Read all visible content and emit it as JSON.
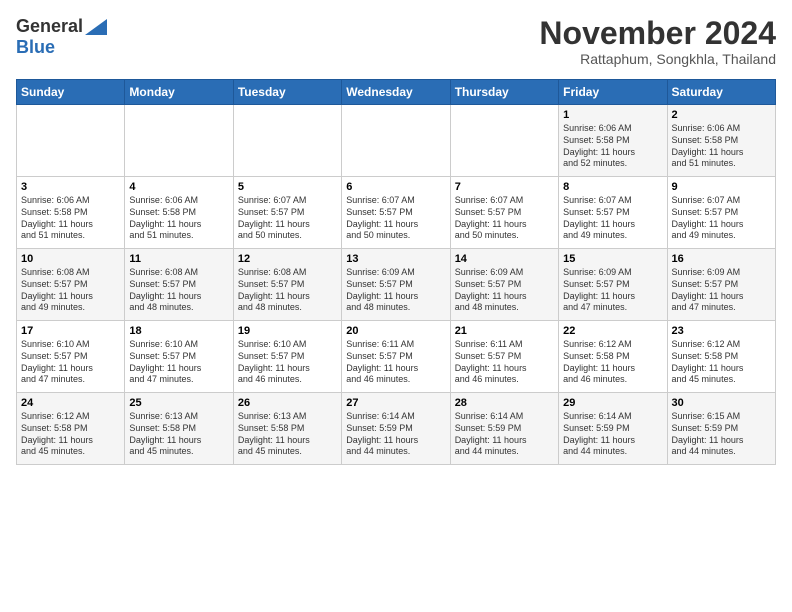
{
  "header": {
    "logo_general": "General",
    "logo_blue": "Blue",
    "month_title": "November 2024",
    "location": "Rattaphum, Songkhla, Thailand"
  },
  "days_of_week": [
    "Sunday",
    "Monday",
    "Tuesday",
    "Wednesday",
    "Thursday",
    "Friday",
    "Saturday"
  ],
  "weeks": [
    [
      {
        "day": "",
        "info": ""
      },
      {
        "day": "",
        "info": ""
      },
      {
        "day": "",
        "info": ""
      },
      {
        "day": "",
        "info": ""
      },
      {
        "day": "",
        "info": ""
      },
      {
        "day": "1",
        "info": "Sunrise: 6:06 AM\nSunset: 5:58 PM\nDaylight: 11 hours\nand 52 minutes."
      },
      {
        "day": "2",
        "info": "Sunrise: 6:06 AM\nSunset: 5:58 PM\nDaylight: 11 hours\nand 51 minutes."
      }
    ],
    [
      {
        "day": "3",
        "info": "Sunrise: 6:06 AM\nSunset: 5:58 PM\nDaylight: 11 hours\nand 51 minutes."
      },
      {
        "day": "4",
        "info": "Sunrise: 6:06 AM\nSunset: 5:58 PM\nDaylight: 11 hours\nand 51 minutes."
      },
      {
        "day": "5",
        "info": "Sunrise: 6:07 AM\nSunset: 5:57 PM\nDaylight: 11 hours\nand 50 minutes."
      },
      {
        "day": "6",
        "info": "Sunrise: 6:07 AM\nSunset: 5:57 PM\nDaylight: 11 hours\nand 50 minutes."
      },
      {
        "day": "7",
        "info": "Sunrise: 6:07 AM\nSunset: 5:57 PM\nDaylight: 11 hours\nand 50 minutes."
      },
      {
        "day": "8",
        "info": "Sunrise: 6:07 AM\nSunset: 5:57 PM\nDaylight: 11 hours\nand 49 minutes."
      },
      {
        "day": "9",
        "info": "Sunrise: 6:07 AM\nSunset: 5:57 PM\nDaylight: 11 hours\nand 49 minutes."
      }
    ],
    [
      {
        "day": "10",
        "info": "Sunrise: 6:08 AM\nSunset: 5:57 PM\nDaylight: 11 hours\nand 49 minutes."
      },
      {
        "day": "11",
        "info": "Sunrise: 6:08 AM\nSunset: 5:57 PM\nDaylight: 11 hours\nand 48 minutes."
      },
      {
        "day": "12",
        "info": "Sunrise: 6:08 AM\nSunset: 5:57 PM\nDaylight: 11 hours\nand 48 minutes."
      },
      {
        "day": "13",
        "info": "Sunrise: 6:09 AM\nSunset: 5:57 PM\nDaylight: 11 hours\nand 48 minutes."
      },
      {
        "day": "14",
        "info": "Sunrise: 6:09 AM\nSunset: 5:57 PM\nDaylight: 11 hours\nand 48 minutes."
      },
      {
        "day": "15",
        "info": "Sunrise: 6:09 AM\nSunset: 5:57 PM\nDaylight: 11 hours\nand 47 minutes."
      },
      {
        "day": "16",
        "info": "Sunrise: 6:09 AM\nSunset: 5:57 PM\nDaylight: 11 hours\nand 47 minutes."
      }
    ],
    [
      {
        "day": "17",
        "info": "Sunrise: 6:10 AM\nSunset: 5:57 PM\nDaylight: 11 hours\nand 47 minutes."
      },
      {
        "day": "18",
        "info": "Sunrise: 6:10 AM\nSunset: 5:57 PM\nDaylight: 11 hours\nand 47 minutes."
      },
      {
        "day": "19",
        "info": "Sunrise: 6:10 AM\nSunset: 5:57 PM\nDaylight: 11 hours\nand 46 minutes."
      },
      {
        "day": "20",
        "info": "Sunrise: 6:11 AM\nSunset: 5:57 PM\nDaylight: 11 hours\nand 46 minutes."
      },
      {
        "day": "21",
        "info": "Sunrise: 6:11 AM\nSunset: 5:57 PM\nDaylight: 11 hours\nand 46 minutes."
      },
      {
        "day": "22",
        "info": "Sunrise: 6:12 AM\nSunset: 5:58 PM\nDaylight: 11 hours\nand 46 minutes."
      },
      {
        "day": "23",
        "info": "Sunrise: 6:12 AM\nSunset: 5:58 PM\nDaylight: 11 hours\nand 45 minutes."
      }
    ],
    [
      {
        "day": "24",
        "info": "Sunrise: 6:12 AM\nSunset: 5:58 PM\nDaylight: 11 hours\nand 45 minutes."
      },
      {
        "day": "25",
        "info": "Sunrise: 6:13 AM\nSunset: 5:58 PM\nDaylight: 11 hours\nand 45 minutes."
      },
      {
        "day": "26",
        "info": "Sunrise: 6:13 AM\nSunset: 5:58 PM\nDaylight: 11 hours\nand 45 minutes."
      },
      {
        "day": "27",
        "info": "Sunrise: 6:14 AM\nSunset: 5:59 PM\nDaylight: 11 hours\nand 44 minutes."
      },
      {
        "day": "28",
        "info": "Sunrise: 6:14 AM\nSunset: 5:59 PM\nDaylight: 11 hours\nand 44 minutes."
      },
      {
        "day": "29",
        "info": "Sunrise: 6:14 AM\nSunset: 5:59 PM\nDaylight: 11 hours\nand 44 minutes."
      },
      {
        "day": "30",
        "info": "Sunrise: 6:15 AM\nSunset: 5:59 PM\nDaylight: 11 hours\nand 44 minutes."
      }
    ]
  ]
}
